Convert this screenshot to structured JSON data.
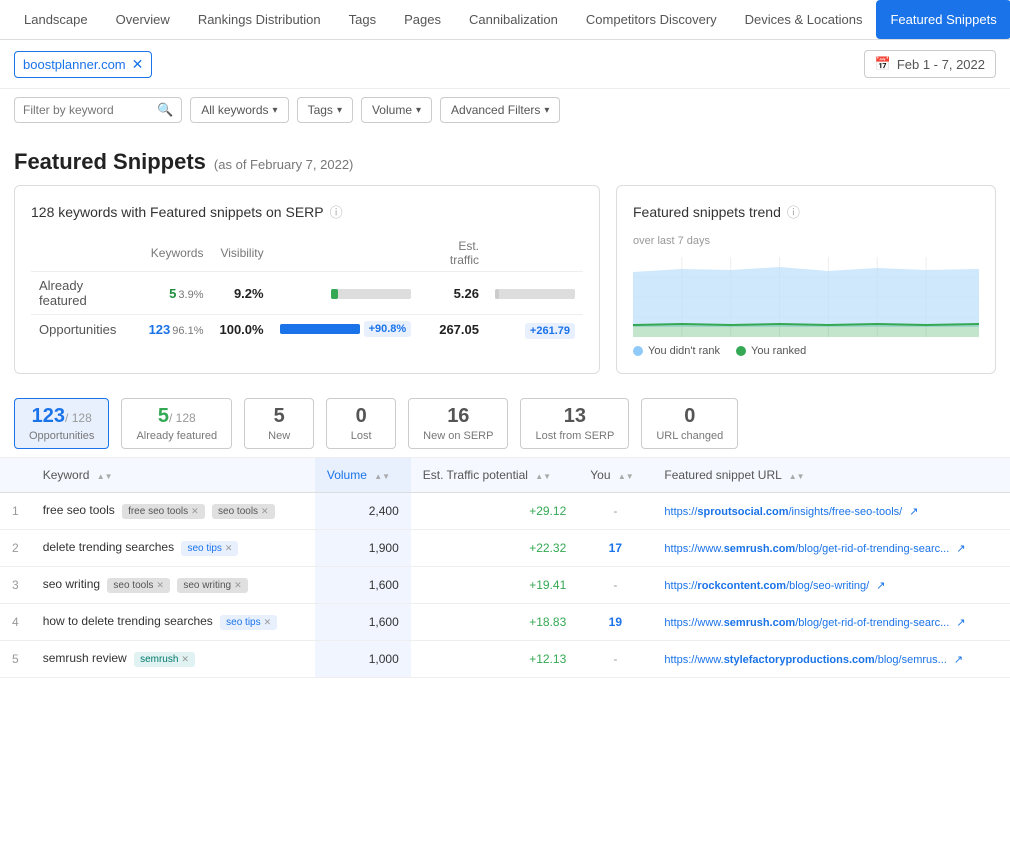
{
  "nav": {
    "items": [
      {
        "label": "Landscape",
        "active": false
      },
      {
        "label": "Overview",
        "active": false
      },
      {
        "label": "Rankings Distribution",
        "active": false
      },
      {
        "label": "Tags",
        "active": false
      },
      {
        "label": "Pages",
        "active": false
      },
      {
        "label": "Cannibalization",
        "active": false
      },
      {
        "label": "Competitors Discovery",
        "active": false
      },
      {
        "label": "Devices & Locations",
        "active": false
      },
      {
        "label": "Featured Snippets",
        "active": true
      }
    ]
  },
  "toolbar": {
    "domain": "boostplanner.com",
    "date_range": "Feb 1 - 7, 2022",
    "calendar_icon": "📅"
  },
  "filters": {
    "keyword_placeholder": "Filter by keyword",
    "search_icon": "🔍",
    "buttons": [
      {
        "label": "All keywords",
        "chevron": "▾"
      },
      {
        "label": "Tags",
        "chevron": "▾"
      },
      {
        "label": "Volume",
        "chevron": "▾"
      },
      {
        "label": "Advanced Filters",
        "chevron": "▾"
      }
    ]
  },
  "page_title": "Featured Snippets",
  "page_subtitle": "(as of February 7, 2022)",
  "summary_card": {
    "title": "128 keywords with Featured snippets on SERP",
    "info_icon": "ⓘ",
    "headers": [
      "Keywords",
      "Visibility",
      "Est. traffic"
    ],
    "rows": [
      {
        "label": "Already featured",
        "count": "5",
        "count_color": "green",
        "pct": "3.9%",
        "visibility": "9.2%",
        "bar_pct": 9,
        "bar_color": "green",
        "traffic": "5.26",
        "traffic_bar_pct": 5,
        "traffic_bar_color": "gray"
      },
      {
        "label": "Opportunities",
        "count": "123",
        "count_color": "blue",
        "pct": "96.1%",
        "visibility": "100.0%",
        "visibility_badge": "+90.8%",
        "bar_pct": 100,
        "bar_color": "blue",
        "traffic": "267.05",
        "traffic_badge": "+261.79"
      }
    ]
  },
  "trend_card": {
    "title": "Featured snippets trend",
    "info_icon": "ⓘ",
    "subtitle": "over last 7 days",
    "legend": [
      {
        "label": "You didn't rank",
        "color": "#90caf9"
      },
      {
        "label": "You ranked",
        "color": "#34a853"
      }
    ]
  },
  "tabs": [
    {
      "label": "Opportunities",
      "count": "123",
      "of": "/ 128",
      "active": true
    },
    {
      "label": "Already featured",
      "count": "5",
      "of": "/ 128",
      "color": "green",
      "active": false
    },
    {
      "label": "New",
      "count": "5",
      "active": false
    },
    {
      "label": "Lost",
      "count": "0",
      "active": false
    },
    {
      "label": "New on SERP",
      "count": "16",
      "active": false
    },
    {
      "label": "Lost from SERP",
      "count": "13",
      "active": false
    },
    {
      "label": "URL changed",
      "count": "0",
      "active": false
    }
  ],
  "table": {
    "columns": [
      "Keyword",
      "Volume",
      "Est. Traffic potential",
      "You",
      "Featured snippet URL"
    ],
    "rows": [
      {
        "num": "1",
        "keyword": "free seo tools",
        "tags": [
          {
            "label": "free seo tools",
            "type": "gray",
            "removable": true
          },
          {
            "label": "seo tools",
            "type": "gray",
            "removable": true
          }
        ],
        "volume": "2,400",
        "traffic": "+29.12",
        "you": "-",
        "url_prefix": "https://",
        "url_domain": "sproutsocial.com",
        "url_domain_bold": true,
        "url_path": "/insights/free-seo-tools/"
      },
      {
        "num": "2",
        "keyword": "delete trending searches",
        "tags": [
          {
            "label": "seo tips",
            "type": "blue",
            "removable": true
          }
        ],
        "volume": "1,900",
        "traffic": "+22.32",
        "you": "17",
        "url_prefix": "https://www.",
        "url_domain": "semrush.com",
        "url_domain_bold": true,
        "url_path": "/blog/get-rid-of-trending-searc..."
      },
      {
        "num": "3",
        "keyword": "seo writing",
        "tags": [
          {
            "label": "seo tools",
            "type": "gray",
            "removable": true
          },
          {
            "label": "seo writing",
            "type": "gray",
            "removable": true
          }
        ],
        "volume": "1,600",
        "traffic": "+19.41",
        "you": "-",
        "url_prefix": "https://",
        "url_domain": "rockcontent.com",
        "url_domain_bold": true,
        "url_path": "/blog/seo-writing/"
      },
      {
        "num": "4",
        "keyword": "how to delete trending searches",
        "tags": [
          {
            "label": "seo tips",
            "type": "blue",
            "removable": true
          }
        ],
        "volume": "1,600",
        "traffic": "+18.83",
        "you": "19",
        "url_prefix": "https://www.",
        "url_domain": "semrush.com",
        "url_domain_bold": true,
        "url_path": "/blog/get-rid-of-trending-searc..."
      },
      {
        "num": "5",
        "keyword": "semrush review",
        "tags": [
          {
            "label": "semrush",
            "type": "teal",
            "removable": true
          }
        ],
        "volume": "1,000",
        "traffic": "+12.13",
        "you": "-",
        "url_prefix": "https://www.",
        "url_domain": "stylefactoryproductions.com",
        "url_domain_bold": true,
        "url_path": "/blog/semrus..."
      }
    ]
  }
}
